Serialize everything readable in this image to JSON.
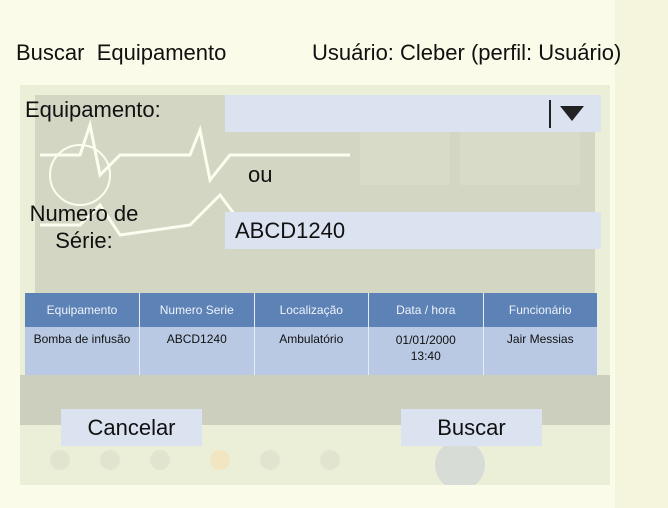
{
  "header": {
    "title": "Buscar  Equipamento",
    "user": "Usuário: Cleber (perfil: Usuário)"
  },
  "form": {
    "equipment_label": "Equipamento:",
    "equipment_value": "",
    "or_label": "ou",
    "serial_label_line1": "Numero de",
    "serial_label_line2": "Série:",
    "serial_value": "ABCD1240"
  },
  "table": {
    "columns": [
      "Equipamento",
      "Numero Serie",
      "Localização",
      "Data / hora",
      "Funcionário"
    ],
    "rows": [
      {
        "equipment": "Bomba de infusão",
        "serial": "ABCD1240",
        "location": "Ambulatório",
        "date": "01/01/2000",
        "time": "13:40",
        "employee": "Jair Messias"
      }
    ]
  },
  "buttons": {
    "cancel": "Cancelar",
    "search": "Buscar"
  },
  "icons": {
    "dropdown": "chevron-down-icon"
  }
}
